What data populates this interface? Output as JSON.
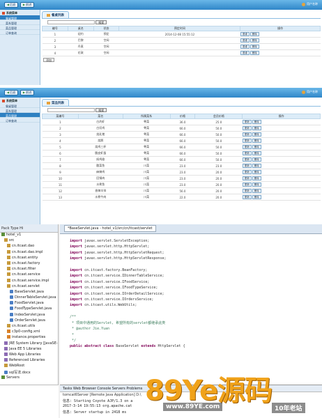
{
  "panel1": {
    "back_label": "后退",
    "forward_label": "前进",
    "user_label": "用户名称",
    "side_title": "系统菜单",
    "side_items": [
      "餐桌管理",
      "菜系管理",
      "菜品管理",
      "订单查询"
    ],
    "active_index": 0,
    "tab_label": "餐桌列表",
    "search_button": "搜索",
    "columns": [
      "编号",
      "桌名",
      "状态",
      "预定时间",
      "操作"
    ],
    "rows": [
      [
        "1",
        "纽约",
        "预定",
        "2014-12-08 15:55:12"
      ],
      [
        "2",
        "巴黎",
        "空闲",
        ""
      ],
      [
        "3",
        "丹麦",
        "空闲",
        ""
      ],
      [
        "4",
        "伦敦",
        "空闲",
        ""
      ]
    ],
    "action_labels": [
      "退桌",
      "删除"
    ],
    "add_button": "添加"
  },
  "panel2": {
    "back_label": "后退",
    "forward_label": "前进",
    "user_label": "用户名称",
    "side_title": "系统菜单",
    "side_items": [
      "餐桌管理",
      "菜系管理",
      "菜品管理",
      "订单查询"
    ],
    "active_index": 2,
    "tab_label": "菜品列表",
    "search_button": "搜索",
    "columns": [
      "菜编号",
      "菜名",
      "所属菜系",
      "价格",
      "会员价格",
      "操作"
    ],
    "rows": [
      [
        "1",
        "白灼虾",
        "粤菜",
        "36.0",
        "25.0"
      ],
      [
        "2",
        "白切鸡",
        "粤菜",
        "66.0",
        "50.0"
      ],
      [
        "3",
        "烧乳猪",
        "粤菜",
        "66.0",
        "50.0"
      ],
      [
        "4",
        "烧鹅",
        "粤菜",
        "66.0",
        "50.0"
      ],
      [
        "5",
        "烧鸡三杯",
        "粤菜",
        "66.0",
        "50.0"
      ],
      [
        "6",
        "脆皮虾蛋",
        "粤菜",
        "66.0",
        "50.0"
      ],
      [
        "7",
        "焖鸡翅",
        "粤菜",
        "66.0",
        "50.0"
      ],
      [
        "8",
        "酸菜鱼",
        "川菜",
        "23.0",
        "23.0"
      ],
      [
        "9",
        "麻辣鸡",
        "川菜",
        "23.0",
        "20.0"
      ],
      [
        "10",
        "回锅肉",
        "川菜",
        "23.0",
        "20.0"
      ],
      [
        "11",
        "水煮鱼",
        "川菜",
        "23.0",
        "20.0"
      ],
      [
        "12",
        "香辣羊排",
        "川菜",
        "56.0",
        "20.0"
      ],
      [
        "13",
        "水煮牛肉",
        "川菜",
        "22.0",
        "20.0"
      ]
    ],
    "action_labels": [
      "更新",
      "删除"
    ]
  },
  "ide": {
    "left_tabs": "Pack Type Hi",
    "tree": [
      {
        "label": "hotel_v1",
        "kind": "prj",
        "indent": 0
      },
      {
        "label": "src",
        "kind": "pkg",
        "indent": 1
      },
      {
        "label": "cn.itcast.dao",
        "kind": "pkg",
        "indent": 2
      },
      {
        "label": "cn.itcast.dao.impl",
        "kind": "pkg",
        "indent": 2
      },
      {
        "label": "cn.itcast.entity",
        "kind": "pkg",
        "indent": 2
      },
      {
        "label": "cn.itcast.factory",
        "kind": "pkg",
        "indent": 2
      },
      {
        "label": "cn.itcast.filter",
        "kind": "pkg",
        "indent": 2
      },
      {
        "label": "cn.itcast.service",
        "kind": "pkg",
        "indent": 2
      },
      {
        "label": "cn.itcast.service.impl",
        "kind": "pkg",
        "indent": 2
      },
      {
        "label": "cn.itcast.servlet",
        "kind": "pkg",
        "indent": 2
      },
      {
        "label": "BaseServlet.java",
        "kind": "jfile",
        "indent": 3
      },
      {
        "label": "DinnerTableServlet.java",
        "kind": "jfile",
        "indent": 3
      },
      {
        "label": "FoodServlet.java",
        "kind": "jfile",
        "indent": 3
      },
      {
        "label": "FoodTypeServlet.java",
        "kind": "jfile",
        "indent": 3
      },
      {
        "label": "IndexServlet.java",
        "kind": "jfile",
        "indent": 3
      },
      {
        "label": "OrderServlet.java",
        "kind": "jfile",
        "indent": 3
      },
      {
        "label": "cn.itcast.utils",
        "kind": "pkg",
        "indent": 2
      },
      {
        "label": "c3p0-config.xml",
        "kind": "xml",
        "indent": 2
      },
      {
        "label": "instance.properties",
        "kind": "xml",
        "indent": 2
      },
      {
        "label": "JRE System Library [JavaSE-1.6]",
        "kind": "lib",
        "indent": 1
      },
      {
        "label": "Java EE 5 Libraries",
        "kind": "lib",
        "indent": 1
      },
      {
        "label": "Web App Libraries",
        "kind": "lib",
        "indent": 1
      },
      {
        "label": "Referenced Libraries",
        "kind": "lib",
        "indent": 1
      },
      {
        "label": "WebRoot",
        "kind": "pkg",
        "indent": 1
      },
      {
        "label": "sql写法.docx",
        "kind": "jfile",
        "indent": 1
      },
      {
        "label": "Servers",
        "kind": "prj",
        "indent": 0
      }
    ],
    "editor_tab": "*BaseServlet.java - hotel_v1/src/cn/itcast/servlet",
    "code_lines": [
      {
        "t": "import javax.servlet.ServletException;",
        "k": "import"
      },
      {
        "t": "import javax.servlet.http.HttpServlet;",
        "k": "import"
      },
      {
        "t": "import javax.servlet.http.HttpServletRequest;",
        "k": "import"
      },
      {
        "t": "import javax.servlet.http.HttpServletResponse;",
        "k": "import"
      },
      {
        "t": "",
        "k": ""
      },
      {
        "t": "import cn.itcast.factory.BeanFactory;",
        "k": "import"
      },
      {
        "t": "import cn.itcast.service.IDinnerTableService;",
        "k": "import"
      },
      {
        "t": "import cn.itcast.service.IFoodService;",
        "k": "import"
      },
      {
        "t": "import cn.itcast.service.IFoodTypeService;",
        "k": "import"
      },
      {
        "t": "import cn.itcast.service.IOrderDetailService;",
        "k": "import"
      },
      {
        "t": "import cn.itcast.service.IOrdersService;",
        "k": "import"
      },
      {
        "t": "import cn.itcast.utils.WebUtils;",
        "k": "import"
      },
      {
        "t": "",
        "k": ""
      },
      {
        "t": "/**",
        "k": "cm"
      },
      {
        "t": " * 项目中通用的Servlet, 希望所有的servlet都继承此类",
        "k": "cm"
      },
      {
        "t": " * @author Jie.Yuan",
        "k": "cm"
      },
      {
        "t": " *",
        "k": "cm"
      },
      {
        "t": " */",
        "k": "cm"
      },
      {
        "t": "public abstract class BaseServlet extends HttpServlet {",
        "k": "class"
      }
    ],
    "console_tabs": "Tasks  Web Browser  Console  Servers  Problems",
    "console_title": "tomcat6Server [Remote Java Application] D:\\",
    "console_lines": [
      "信息: Starting Coyote AJP/1.3 on a",
      "2017-3-14 19:55:13 org.apache.cat",
      "信息: Server startup in 2418 ms"
    ]
  },
  "watermark": {
    "main": "89Ye源码",
    "url": "www.89YE.com",
    "tag": "10年老站"
  }
}
